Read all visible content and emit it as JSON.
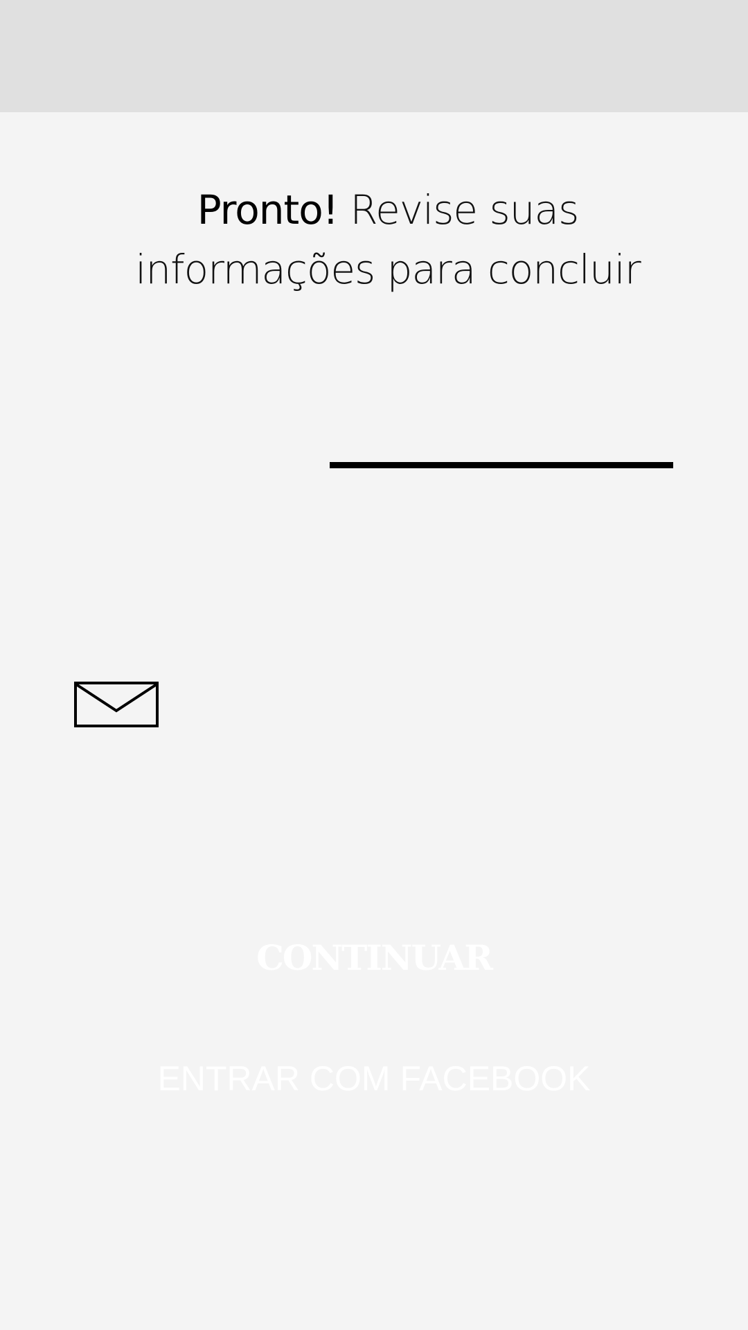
{
  "header": {
    "title_strong": "Pronto!",
    "title_light_line1": "Revise suas",
    "title_light_line2": "informações para concluir"
  },
  "email_row": {
    "icon": "envelope-icon"
  },
  "actions": {
    "continue_label": "CONTINUAR",
    "facebook_label": "ENTRAR COM FACEBOOK"
  },
  "colors": {
    "background": "#f4f4f4",
    "status_bar": "#e0e0e0",
    "text_primary": "#111111",
    "button_text": "#ffffff",
    "accent_line": "#000000"
  }
}
